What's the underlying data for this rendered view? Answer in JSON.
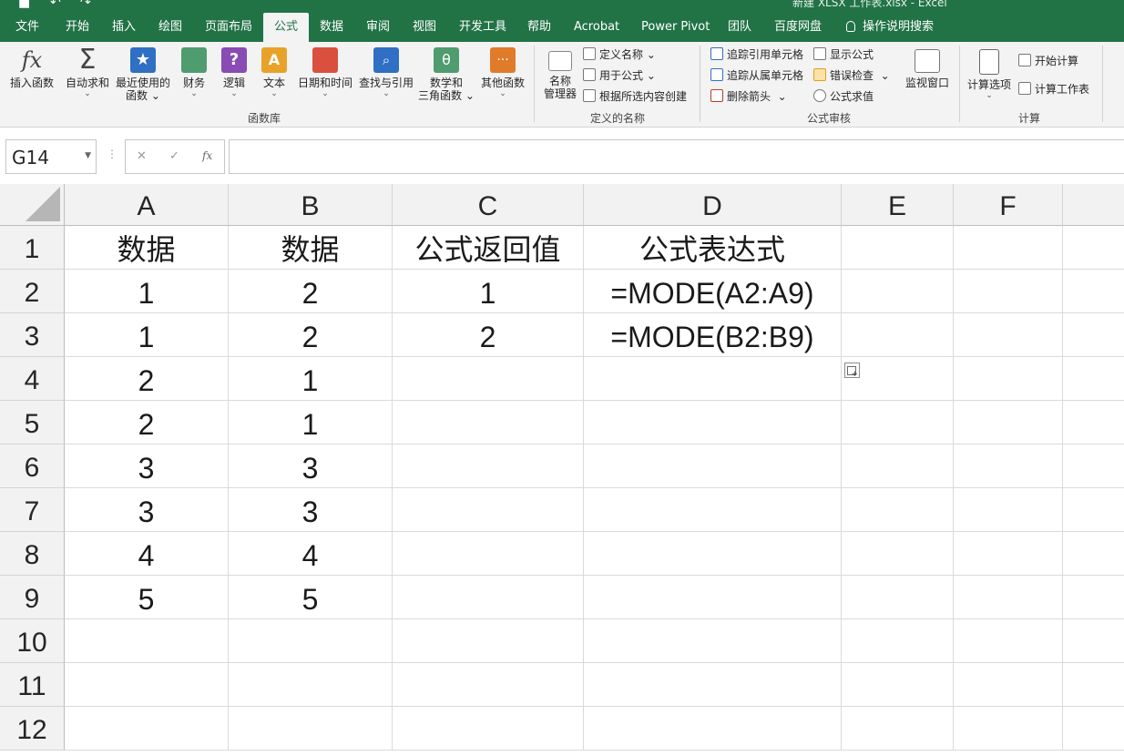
{
  "window": {
    "doc_title": "新建 XLSX 工作表.xlsx  -  Excel"
  },
  "tabs": [
    {
      "label": "文件"
    },
    {
      "label": "开始"
    },
    {
      "label": "插入"
    },
    {
      "label": "绘图"
    },
    {
      "label": "页面布局"
    },
    {
      "label": "公式"
    },
    {
      "label": "数据"
    },
    {
      "label": "审阅"
    },
    {
      "label": "视图"
    },
    {
      "label": "开发工具"
    },
    {
      "label": "帮助"
    },
    {
      "label": "Acrobat"
    },
    {
      "label": "Power Pivot"
    },
    {
      "label": "团队"
    },
    {
      "label": "百度网盘"
    },
    {
      "label": "操作说明搜索"
    }
  ],
  "active_tab": "公式",
  "ribbon": {
    "function_library": {
      "group_label": "函数库",
      "insert_function": "插入函数",
      "autosum": "自动求和",
      "recent_line1": "最近使用的",
      "recent_line2": "函数",
      "financial": "财务",
      "logical": "逻辑",
      "text": "文本",
      "datetime": "日期和时间",
      "lookup": "查找与引用",
      "math_line1": "数学和",
      "math_line2": "三角函数",
      "more": "其他函数"
    },
    "defined_names": {
      "group_label": "定义的名称",
      "name_manager_line1": "名称",
      "name_manager_line2": "管理器",
      "define_name": "定义名称",
      "use_in_formula": "用于公式",
      "create_from_selection": "根据所选内容创建"
    },
    "formula_auditing": {
      "group_label": "公式审核",
      "trace_precedents": "追踪引用单元格",
      "trace_dependents": "追踪从属单元格",
      "remove_arrows": "删除箭头",
      "show_formulas": "显示公式",
      "error_checking": "错误检查",
      "evaluate_formula": "公式求值",
      "watch_window": "监视窗口"
    },
    "calculation": {
      "group_label": "计算",
      "calc_options": "计算选项",
      "calc_now": "开始计算",
      "calc_sheet": "计算工作表"
    }
  },
  "formula_bar": {
    "name_box": "G14",
    "fx": "fx",
    "formula": ""
  },
  "sheet": {
    "columns": [
      "A",
      "B",
      "C",
      "D",
      "E",
      "F"
    ],
    "rows": [
      "1",
      "2",
      "3",
      "4",
      "5",
      "6",
      "7",
      "8",
      "9",
      "10",
      "11",
      "12"
    ],
    "cells": [
      [
        "数据",
        "数据",
        "公式返回值",
        "公式表达式",
        "",
        ""
      ],
      [
        "1",
        "2",
        "1",
        "=MODE(A2:A9)",
        "",
        ""
      ],
      [
        "1",
        "2",
        "2",
        "=MODE(B2:B9)",
        "",
        ""
      ],
      [
        "2",
        "1",
        "",
        "",
        "",
        ""
      ],
      [
        "2",
        "1",
        "",
        "",
        "",
        ""
      ],
      [
        "3",
        "3",
        "",
        "",
        "",
        ""
      ],
      [
        "3",
        "3",
        "",
        "",
        "",
        ""
      ],
      [
        "4",
        "4",
        "",
        "",
        "",
        ""
      ],
      [
        "5",
        "5",
        "",
        "",
        "",
        ""
      ],
      [
        "",
        "",
        "",
        "",
        "",
        ""
      ],
      [
        "",
        "",
        "",
        "",
        "",
        ""
      ],
      [
        "",
        "",
        "",
        "",
        "",
        ""
      ]
    ]
  },
  "colors": {
    "excel_green": "#217346",
    "ribbon_bg": "#f3f3f3",
    "header_bg": "#f2f2f2"
  }
}
